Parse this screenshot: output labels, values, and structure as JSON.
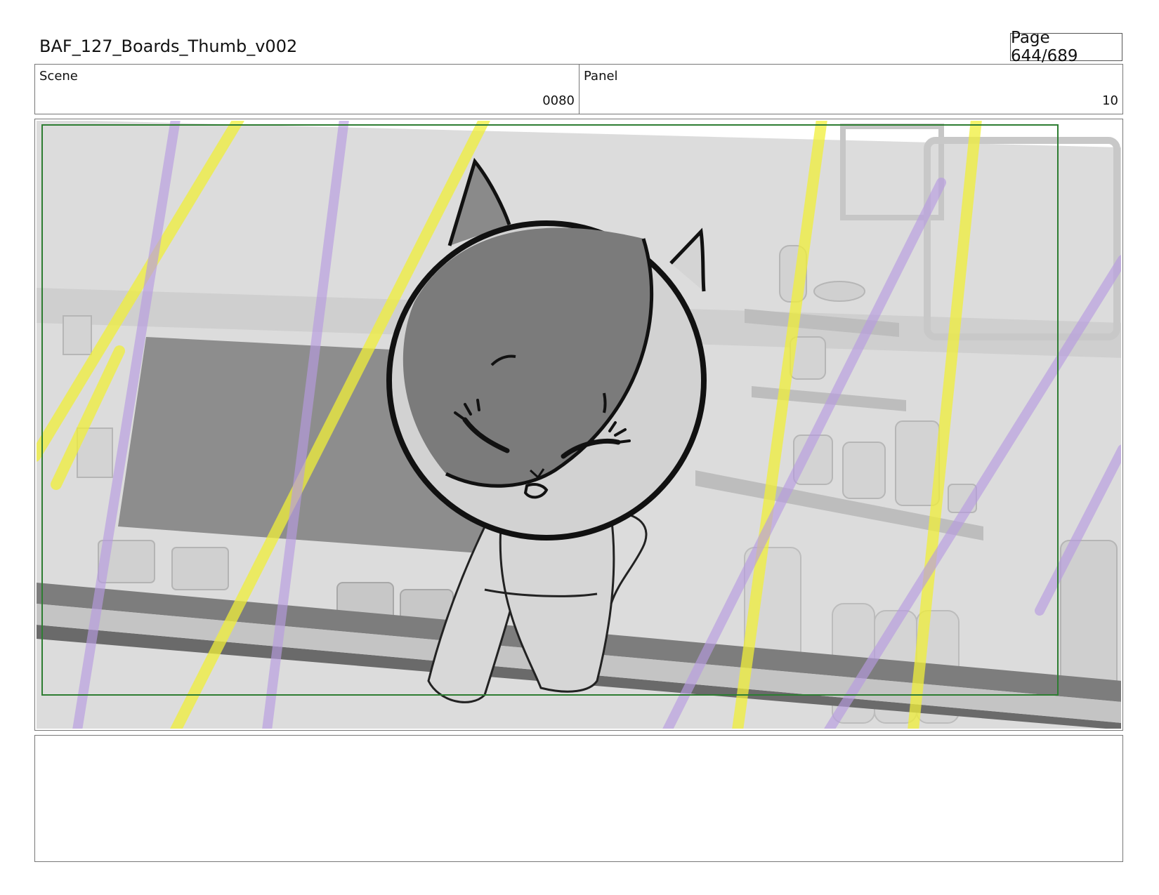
{
  "document": {
    "title": "BAF_127_Boards_Thumb_v002",
    "page_label": "Page 644/689"
  },
  "info": {
    "scene_label": "Scene",
    "scene_value": "0080",
    "panel_label": "Panel",
    "panel_value": "10"
  },
  "frame": {
    "safe_area_color": "#2e7d32",
    "background_tone": "#d9d9d9",
    "overlay_yellow": "#f0ef3a",
    "overlay_purple": "#b79be0",
    "character": "cat-character"
  },
  "notes": {
    "text": ""
  }
}
